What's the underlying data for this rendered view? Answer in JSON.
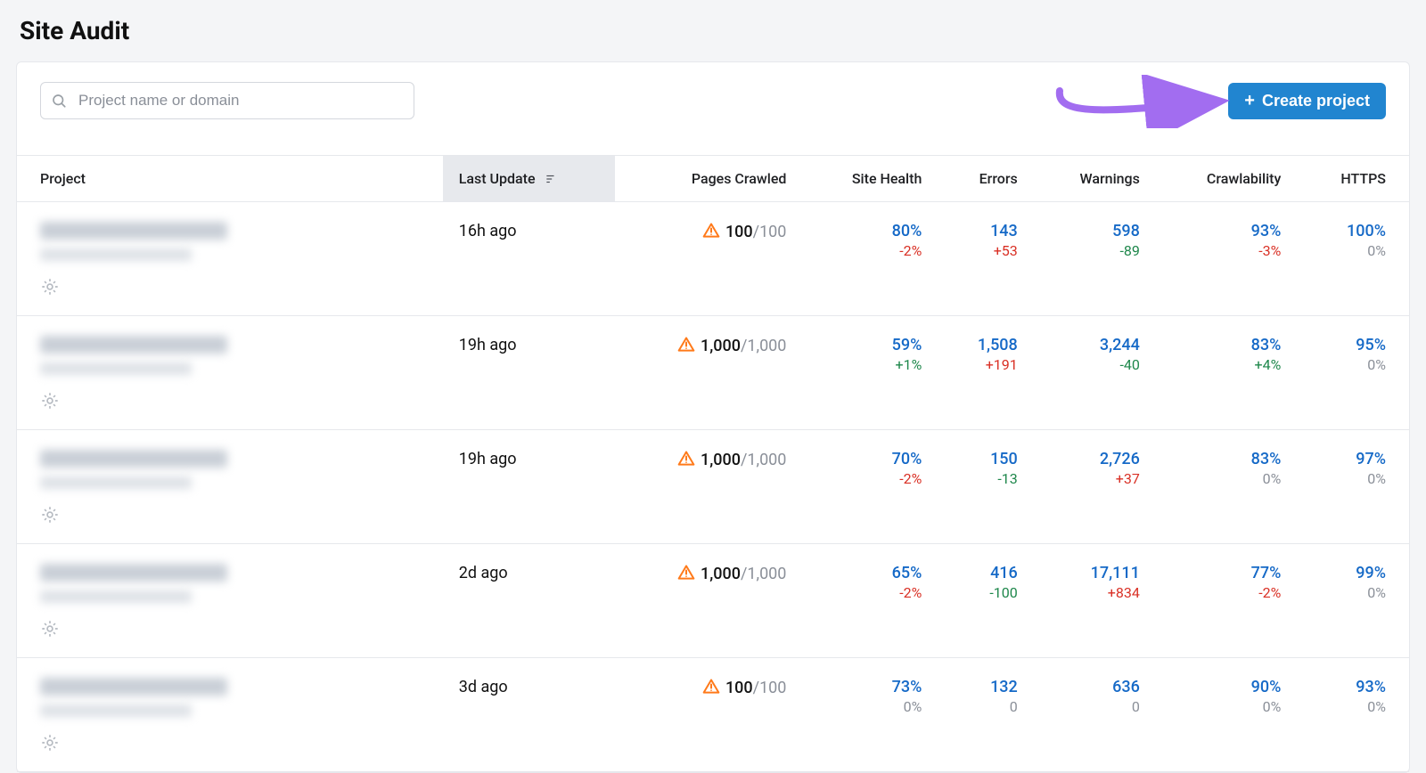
{
  "page_title": "Site Audit",
  "search_placeholder": "Project name or domain",
  "create_button_label": "Create project",
  "columns": {
    "project": "Project",
    "last_update": "Last Update",
    "pages_crawled": "Pages Crawled",
    "site_health": "Site Health",
    "errors": "Errors",
    "warnings": "Warnings",
    "crawlability": "Crawlability",
    "https": "HTTPS"
  },
  "rows": [
    {
      "last_update": "16h ago",
      "crawled": "100",
      "crawled_total": "/100",
      "health": "80%",
      "health_delta": "-2%",
      "health_sign": "neg",
      "errors": "143",
      "errors_delta": "+53",
      "errors_sign": "neg",
      "warnings": "598",
      "warnings_delta": "-89",
      "warnings_sign": "pos",
      "crawlability": "93%",
      "crawlability_delta": "-3%",
      "crawlability_sign": "neg",
      "https": "100%",
      "https_delta": "0%",
      "https_sign": "zero"
    },
    {
      "last_update": "19h ago",
      "crawled": "1,000",
      "crawled_total": "/1,000",
      "health": "59%",
      "health_delta": "+1%",
      "health_sign": "pos",
      "errors": "1,508",
      "errors_delta": "+191",
      "errors_sign": "neg",
      "warnings": "3,244",
      "warnings_delta": "-40",
      "warnings_sign": "pos",
      "crawlability": "83%",
      "crawlability_delta": "+4%",
      "crawlability_sign": "pos",
      "https": "95%",
      "https_delta": "0%",
      "https_sign": "zero"
    },
    {
      "last_update": "19h ago",
      "crawled": "1,000",
      "crawled_total": "/1,000",
      "health": "70%",
      "health_delta": "-2%",
      "health_sign": "neg",
      "errors": "150",
      "errors_delta": "-13",
      "errors_sign": "pos",
      "warnings": "2,726",
      "warnings_delta": "+37",
      "warnings_sign": "neg",
      "crawlability": "83%",
      "crawlability_delta": "0%",
      "crawlability_sign": "zero",
      "https": "97%",
      "https_delta": "0%",
      "https_sign": "zero"
    },
    {
      "last_update": "2d ago",
      "crawled": "1,000",
      "crawled_total": "/1,000",
      "health": "65%",
      "health_delta": "-2%",
      "health_sign": "neg",
      "errors": "416",
      "errors_delta": "-100",
      "errors_sign": "pos",
      "warnings": "17,111",
      "warnings_delta": "+834",
      "warnings_sign": "neg",
      "crawlability": "77%",
      "crawlability_delta": "-2%",
      "crawlability_sign": "neg",
      "https": "99%",
      "https_delta": "0%",
      "https_sign": "zero"
    },
    {
      "last_update": "3d ago",
      "crawled": "100",
      "crawled_total": "/100",
      "health": "73%",
      "health_delta": "0%",
      "health_sign": "zero",
      "errors": "132",
      "errors_delta": "0",
      "errors_sign": "zero",
      "warnings": "636",
      "warnings_delta": "0",
      "warnings_sign": "zero",
      "crawlability": "90%",
      "crawlability_delta": "0%",
      "crawlability_sign": "zero",
      "https": "93%",
      "https_delta": "0%",
      "https_sign": "zero"
    }
  ]
}
